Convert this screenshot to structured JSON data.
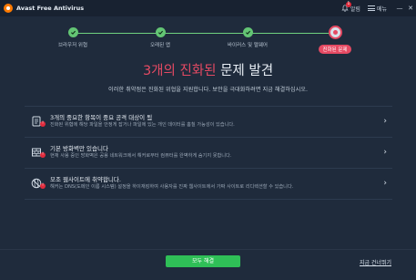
{
  "app": {
    "title": "Avast Free Antivirus",
    "notifications_label": "알림",
    "notifications_count": "1",
    "menu_label": "메뉴"
  },
  "steps": [
    {
      "label": "브라우저 위협",
      "state": "done"
    },
    {
      "label": "오래된 앱",
      "state": "done"
    },
    {
      "label": "바이러스 및 맬웨어",
      "state": "done"
    },
    {
      "label": "진화된 문제",
      "state": "current"
    }
  ],
  "headline": {
    "highlight": "3개의 진화된",
    "rest": " 문제 발견"
  },
  "subline": "이러한 취약점은 진화된 위협을 지원합니다. 보안을 극대화하려면 지금 해결하십시오.",
  "issues": [
    {
      "title": "3개의 중요한 항목이 중요 공격 대상이 됨",
      "desc": "진화된 위협에 해당 파일을 안정게 잡거나 파일에 있는 개인 데이터를 훔칠 가능성이 있습니다.",
      "icon": "document-icon"
    },
    {
      "title": "기본 방화벽만 있습니다",
      "desc": "현재 사용 중인 방화벽은 공용 네트워크에서 해커로부터 컴퓨터를 완벽하게 숨기지 못합니다.",
      "icon": "firewall-icon"
    },
    {
      "title": "모조 웹사이트에 취약합니다.",
      "desc": "해커는 DNS(도메인 이름 시스템) 설정을 하이재킹하여 사용자를 진짜 웹사이트에서 가짜 사이트로 리디렉션할 수 있습니다.",
      "icon": "dns-icon"
    }
  ],
  "footer": {
    "resolve_label": "모두 해결",
    "skip_label": "지금 건너뛰기"
  }
}
